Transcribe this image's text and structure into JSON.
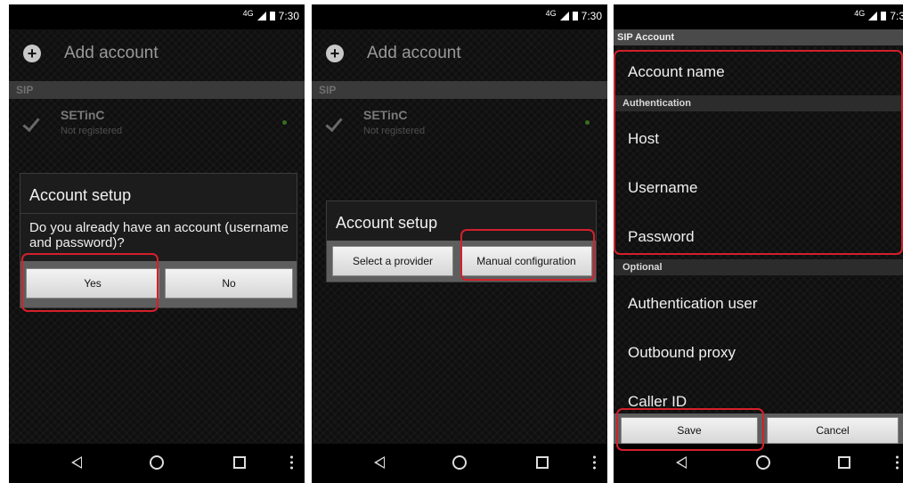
{
  "status": {
    "network": "4G",
    "time": "7:30",
    "time_cropped": "7:3"
  },
  "add_account": {
    "title": "Add account"
  },
  "sip_section": {
    "label": "SIP"
  },
  "account": {
    "name": "SETinC",
    "status": "Not registered"
  },
  "dialog1": {
    "title": "Account setup",
    "message": "Do you already have an account (username and password)?",
    "yes": "Yes",
    "no": "No"
  },
  "dialog2": {
    "title": "Account setup",
    "select_provider": "Select a provider",
    "manual_configuration": "Manual configuration"
  },
  "sip_form": {
    "header": "SIP Account",
    "account_name": "Account name",
    "authentication_header": "Authentication",
    "host": "Host",
    "username": "Username",
    "password": "Password",
    "optional_header": "Optional",
    "authentication_user": "Authentication user",
    "outbound_proxy": "Outbound proxy",
    "caller_id": "Caller ID",
    "save": "Save",
    "cancel": "Cancel"
  },
  "colors": {
    "highlight": "#d3202b",
    "status_dot": "#5cc82a",
    "background": "#0f0f0f"
  }
}
